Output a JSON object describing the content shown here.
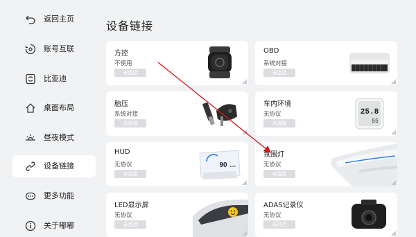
{
  "sidebar": {
    "items": [
      {
        "label": "返回主页",
        "icon": "back-icon"
      },
      {
        "label": "账号互联",
        "icon": "account-link-icon"
      },
      {
        "label": "比亚迪",
        "icon": "byd-icon"
      },
      {
        "label": "桌面布局",
        "icon": "home-icon"
      },
      {
        "label": "昼夜模式",
        "icon": "sun-icon"
      },
      {
        "label": "设备链接",
        "icon": "link-icon",
        "active": true
      },
      {
        "label": "更多功能",
        "icon": "more-icon"
      },
      {
        "label": "关于嘟嘟",
        "icon": "info-icon"
      }
    ]
  },
  "main": {
    "title": "设备链接",
    "devices": [
      {
        "name": "方控",
        "desc": "不使用",
        "status": "未连接",
        "image": "steering-controller"
      },
      {
        "name": "OBD",
        "desc": "系统对接",
        "status": "未连接",
        "image": "obd-box"
      },
      {
        "name": "胎压",
        "desc": "系统对接",
        "status": "未连接",
        "image": "tire-valve"
      },
      {
        "name": "车内环境",
        "desc": "无协议",
        "status": "未连接",
        "image": "thermometer",
        "thermo_temp": "25.8",
        "thermo_hum": "55"
      },
      {
        "name": "HUD",
        "desc": "无协议",
        "status": "未连接",
        "image": "hud",
        "hud_speed": "90",
        "hud_unit": "km/h"
      },
      {
        "name": "氛围灯",
        "desc": "无协议",
        "status": "未连接",
        "image": "ambient-light"
      },
      {
        "name": "LED显示屏",
        "desc": "无协议",
        "status": "未连接",
        "image": "led-screen"
      },
      {
        "name": "ADAS记录仪",
        "desc": "无协议",
        "status": "未开启",
        "image": "dashcam"
      }
    ]
  },
  "colors": {
    "background": "#f1f2f4",
    "card": "#ffffff",
    "status_bg": "#dcdde0",
    "arrow": "#d0191b"
  }
}
